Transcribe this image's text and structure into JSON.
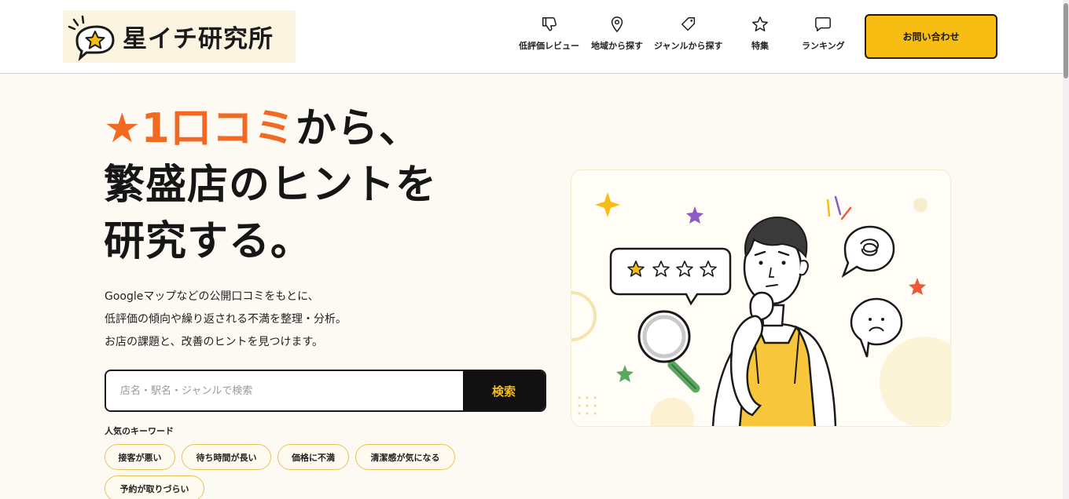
{
  "header": {
    "logo_text": "星イチ研究所",
    "nav": [
      {
        "label": "低評価レビュー",
        "icon": "thumbs-down-icon"
      },
      {
        "label": "地域から探す",
        "icon": "map-pin-icon"
      },
      {
        "label": "ジャンルから探す",
        "icon": "tag-icon"
      },
      {
        "label": "特集",
        "icon": "star-icon"
      },
      {
        "label": "ランキング",
        "icon": "chat-bubble-icon"
      }
    ],
    "contact_label": "お問い合わせ"
  },
  "hero": {
    "title_accent": "★1口コミ",
    "title_line1_rest": "から、",
    "title_line2": "繁盛店のヒントを",
    "title_line3": "研究する。",
    "desc_line1": "Googleマップなどの公開口コミをもとに、",
    "desc_line2": "低評価の傾向や繰り返される不満を整理・分析。",
    "desc_line3": "お店の課題と、改善のヒントを見つけます。"
  },
  "search": {
    "placeholder": "店名・駅名・ジャンルで検索",
    "button_label": "検索"
  },
  "keywords": {
    "label": "人気のキーワード",
    "items": [
      "接客が悪い",
      "待ち時間が長い",
      "価格に不満",
      "清潔感が気になる",
      "予約が取りづらい"
    ]
  },
  "colors": {
    "accent_orange": "#f26a21",
    "brand_yellow": "#f7bd12",
    "background": "#fcfaf3"
  }
}
